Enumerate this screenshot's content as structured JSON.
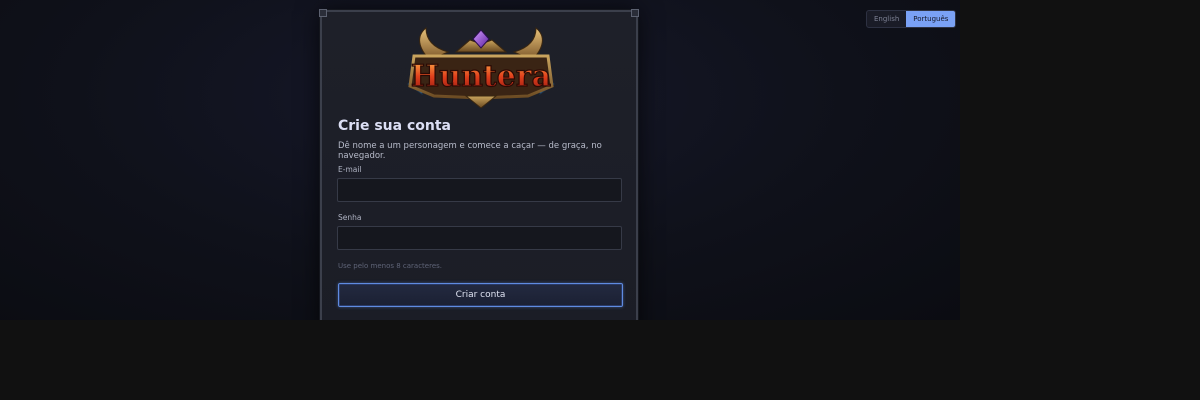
{
  "language_switch": {
    "english_label": "English",
    "portuguese_label": "Português",
    "active": "Português"
  },
  "logo": {
    "text": "Huntera"
  },
  "form": {
    "title": "Crie sua conta",
    "subtitle": "Dê nome a um personagem e comece a caçar — de graça, no navegador.",
    "email_label": "E-mail",
    "email_value": "",
    "password_label": "Senha",
    "password_value": "",
    "password_hint": "Use pelo menos 8 caracteres.",
    "submit_label": "Criar conta"
  },
  "colors": {
    "accent": "#7aa1f5",
    "button_border": "#5f8be0",
    "background": "#0f111a",
    "card": "#1e2029"
  }
}
